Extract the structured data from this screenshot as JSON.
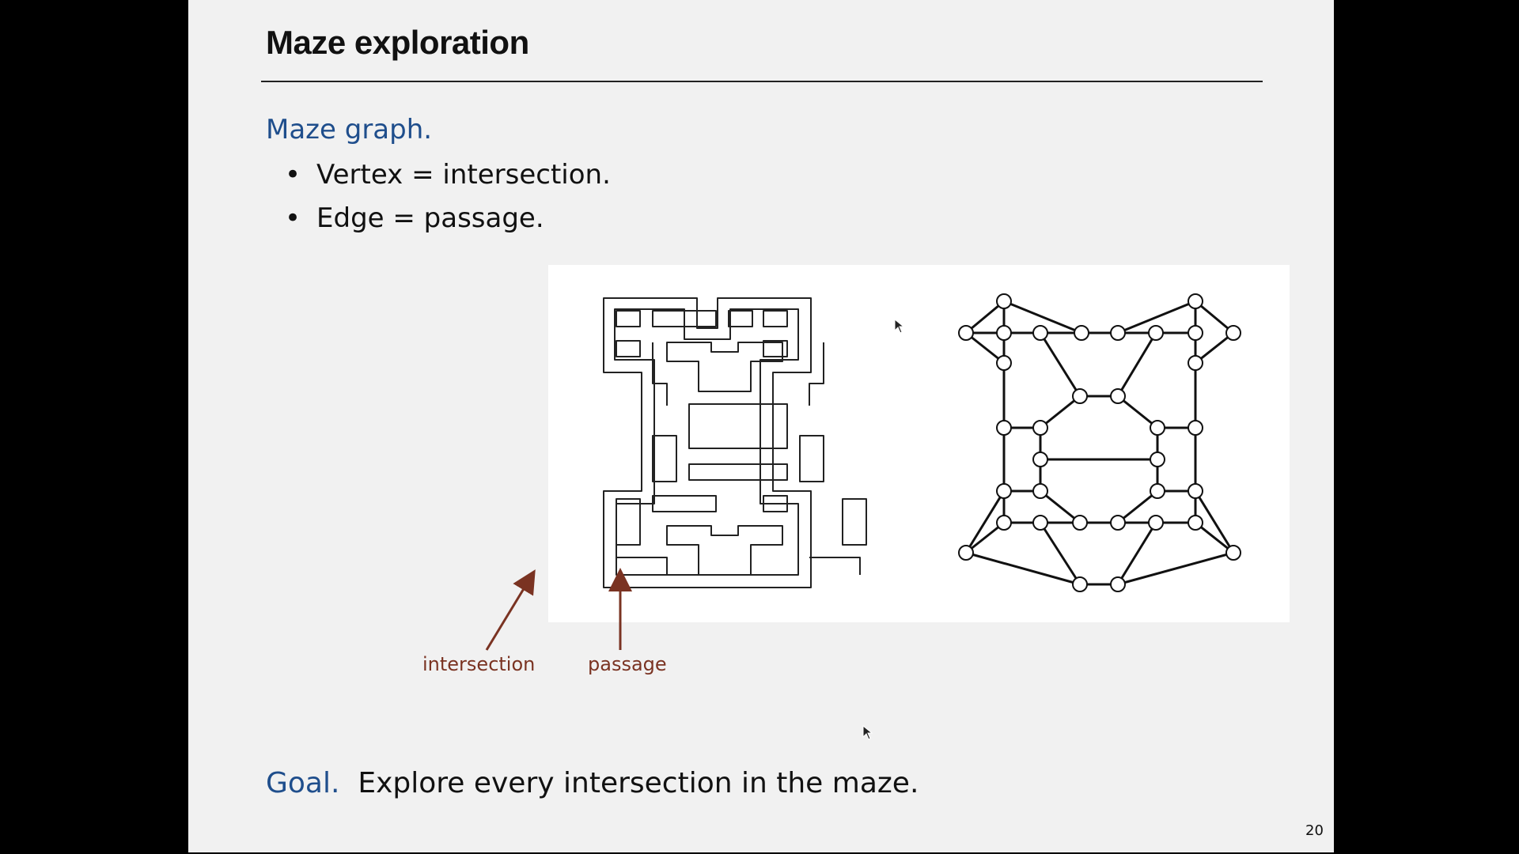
{
  "slide": {
    "title": "Maze exploration",
    "heading": "Maze graph.",
    "bullets": [
      "Vertex = intersection.",
      "Edge = passage."
    ],
    "bullet_glyph": "•",
    "callouts": {
      "intersection": "intersection",
      "passage": "passage"
    },
    "goal_label": "Goal.",
    "goal_text": "  Explore every intersection in the maze.",
    "page_number": "20"
  },
  "colors": {
    "heading": "#1f4e8c",
    "callout": "#7a3322",
    "slide_bg": "#f1f1f1",
    "letterbox": "#000000"
  }
}
